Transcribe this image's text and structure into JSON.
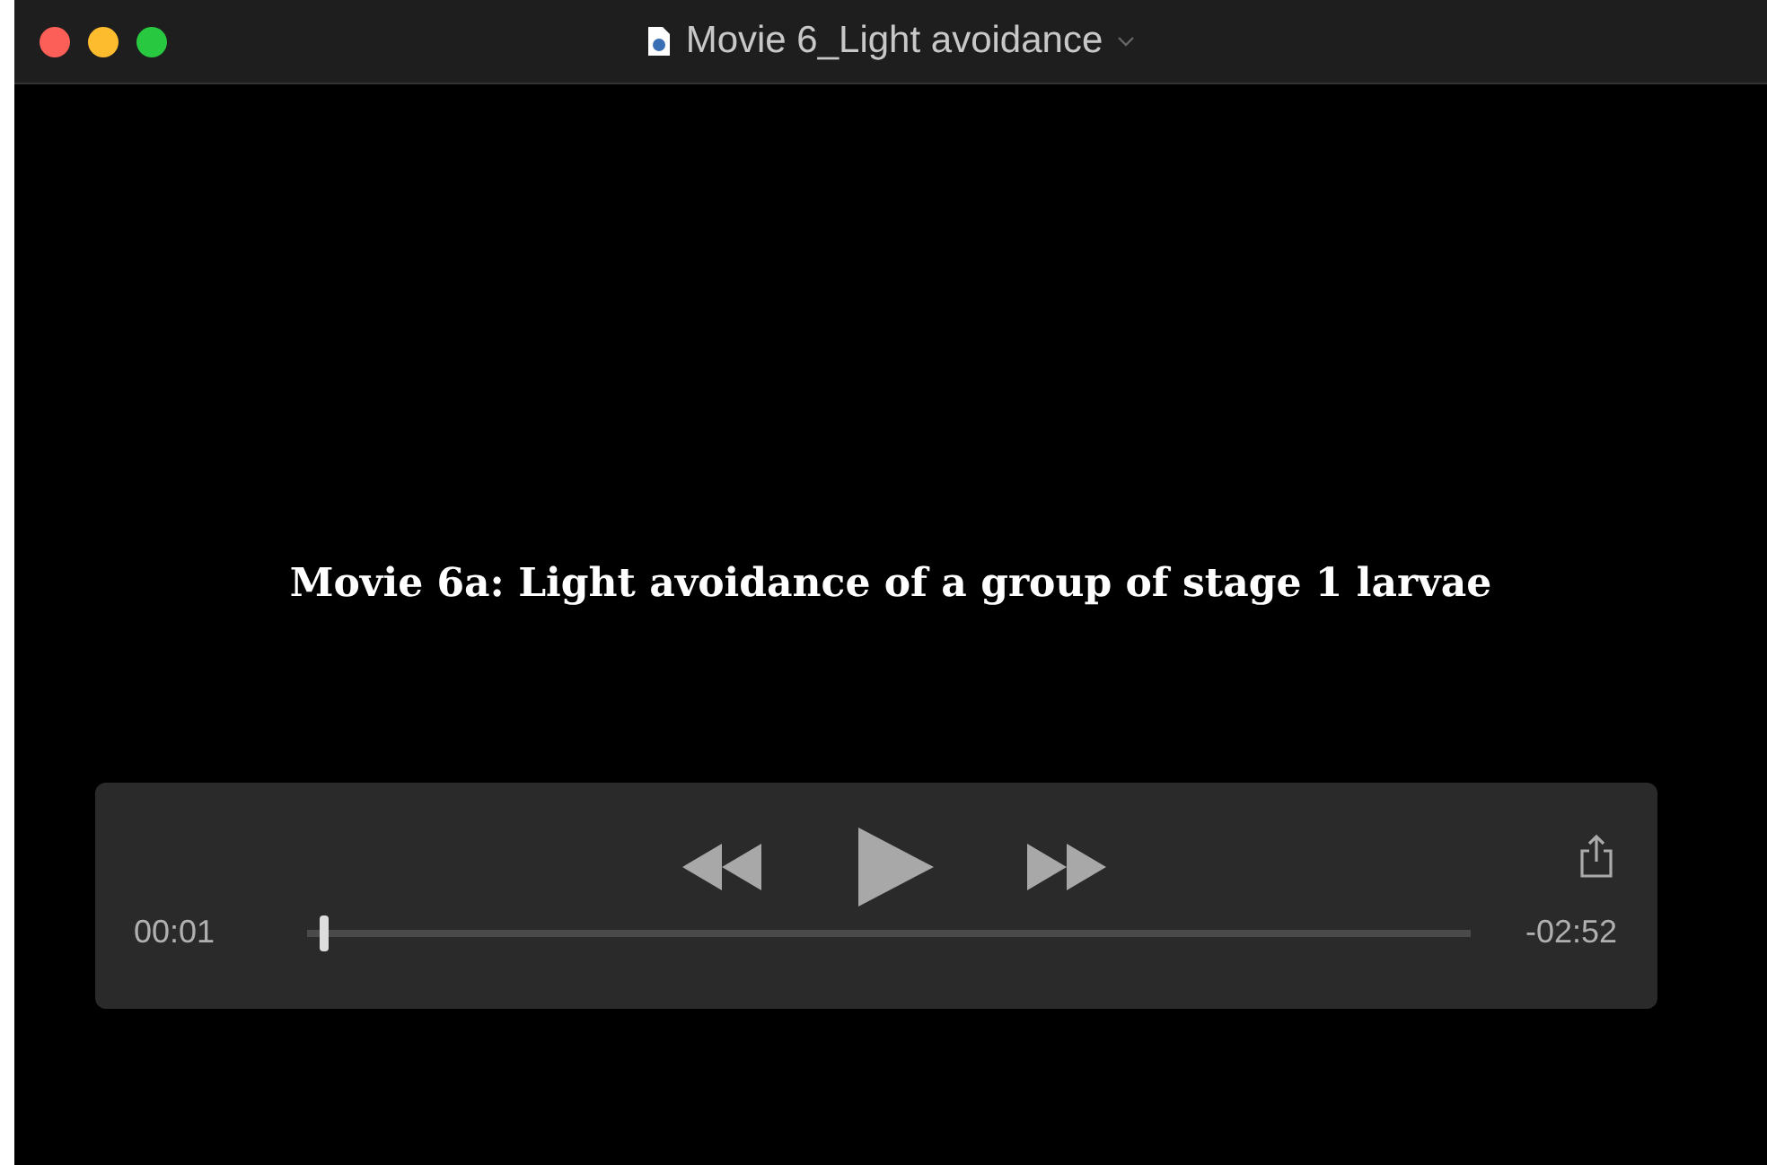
{
  "window": {
    "title": "Movie 6_Light avoidance"
  },
  "video": {
    "caption": "Movie 6a: Light avoidance of a group of stage 1 larvae"
  },
  "controls": {
    "elapsed": "00:01",
    "remaining": "-02:52",
    "playing": false,
    "level": 0.01
  }
}
